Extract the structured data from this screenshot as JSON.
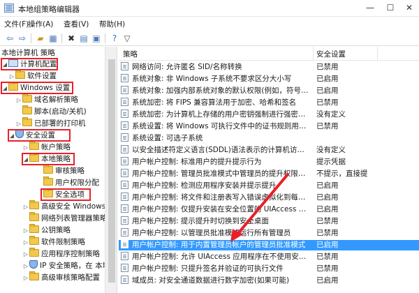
{
  "window": {
    "title": "本地组策略编辑器",
    "min": "—",
    "max": "☐",
    "close": "✕"
  },
  "menu": [
    "文件(F)",
    "操作(A)",
    "查看(V)",
    "帮助(H)"
  ],
  "tree": {
    "root": "本地计算机 策略",
    "computer_config": "计算机配置",
    "software_settings": "软件设置",
    "windows_settings": "Windows 设置",
    "dns_policy": "域名解析策略",
    "scripts": "脚本(启动/关机)",
    "deployed_printers": "已部署的打印机",
    "security_settings": "安全设置",
    "account_policies": "帐户策略",
    "local_policies": "本地策略",
    "audit_policy": "审核策略",
    "user_rights": "用户权限分配",
    "security_options": "安全选项",
    "wf_advanced": "高级安全 Windows 防",
    "network_list": "网络列表管理器策略",
    "public_key": "公钥策略",
    "software_restriction": "软件限制策略",
    "app_control": "应用程序控制策略",
    "ipsec": "IP 安全策略，在 本地",
    "advanced_audit": "高级审核策略配置"
  },
  "list": {
    "col_policy": "策略",
    "col_setting": "安全设置",
    "rows": [
      {
        "policy": "网络访问: 允许匿名 SID/名称转换",
        "setting": "已禁用"
      },
      {
        "policy": "系统对象: 非 Windows 子系统不要求区分大小写",
        "setting": "已启用"
      },
      {
        "policy": "系统对象: 加强内部系统对象的默认权限(例如，符号链接)",
        "setting": "已启用"
      },
      {
        "policy": "系统加密: 将 FIPS 兼容算法用于加密、哈希和签名",
        "setting": "已禁用"
      },
      {
        "policy": "系统加密: 为计算机上存储的用户密钥强制进行强密钥保护",
        "setting": "没有定义"
      },
      {
        "policy": "系统设置: 将 Windows 可执行文件中的证书规则用于软件...",
        "setting": "已禁用"
      },
      {
        "policy": "系统设置: 可选子系统",
        "setting": ""
      },
      {
        "policy": "以安全描述符定义语言(SDDL)语法表示的计算机访问限制",
        "setting": "没有定义"
      },
      {
        "policy": "用户帐户控制: 标准用户的提升提示行为",
        "setting": "提示凭据"
      },
      {
        "policy": "用户帐户控制: 管理员批准模式中管理员的提升权限提示的...",
        "setting": "不提示，直接提"
      },
      {
        "policy": "用户帐户控制: 检测应用程序安装并提示提升",
        "setting": "已启用"
      },
      {
        "policy": "用户帐户控制: 将文件和注册表写入错误虚拟化到每用户位置",
        "setting": "已启用"
      },
      {
        "policy": "用户帐户控制: 仅提升安装在安全位置的 UIAccess 应用程序",
        "setting": "已启用"
      },
      {
        "policy": "用户帐户控制: 提示提升时切换到安全桌面",
        "setting": "已禁用"
      },
      {
        "policy": "用户帐户控制: 以管理员批准模式运行所有管理员",
        "setting": "已禁用"
      },
      {
        "policy": "用户帐户控制: 用于内置管理员帐户的管理员批准模式",
        "setting": "已启用",
        "selected": true
      },
      {
        "policy": "用户帐户控制: 允许 UIAccess 应用程序在不使用安全桌面...",
        "setting": "已禁用"
      },
      {
        "policy": "用户帐户控制: 只提升签名并验证的可执行文件",
        "setting": "已禁用"
      },
      {
        "policy": "域成员: 对安全通道数据进行数字加密(如果可能)",
        "setting": "已启用"
      }
    ]
  },
  "colors": {
    "selection": "#3399ff",
    "annotation": "#e8202a"
  },
  "icons": [
    "back-arrow-icon",
    "forward-arrow-icon",
    "up-folder-icon",
    "show-tree-icon",
    "delete-icon",
    "properties-icon",
    "export-list-icon",
    "help-icon",
    "filter-icon"
  ]
}
